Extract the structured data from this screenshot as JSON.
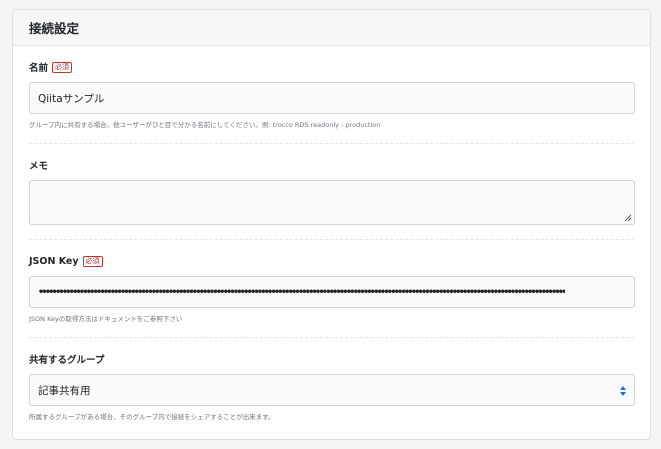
{
  "card": {
    "title": "接続設定"
  },
  "fields": {
    "name": {
      "label": "名前",
      "required_badge": "必須",
      "value": "Qiitaサンプル",
      "help": "グループ内に共有する場合、他ユーザーがひと目で分かる名前にしてください。例: trocco RDS readonly - production"
    },
    "memo": {
      "label": "メモ",
      "value": ""
    },
    "json_key": {
      "label": "JSON Key",
      "required_badge": "必須",
      "masked_value": "••••••••••••••••••••••••••••••••••••••••••••••••••••••••••••••••••••••••••••••••••••••••••••••••••••••••••••••••••••••••••••••••••••••••••••••••••••••••••",
      "help": "JSON Keyの取得方法はドキュメントをご参照下さい"
    },
    "shared_group": {
      "label": "共有するグループ",
      "selected": "記事共有用",
      "help": "所属するグループがある場合、そのグループ内で接続をシェアすることが出来ます。"
    }
  },
  "colors": {
    "required_badge": "#c0392b",
    "select_arrow": "#1e6fd9"
  }
}
